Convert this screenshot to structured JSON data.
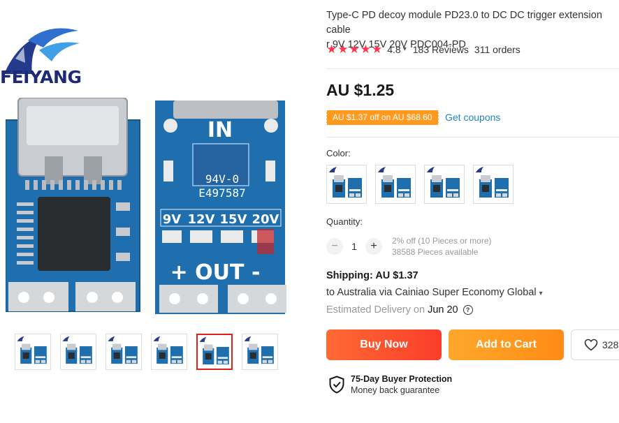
{
  "brand": {
    "logo_text": "FEIYANG"
  },
  "product": {
    "title": "Type-C PD decoy module PD23.0 to DC DC trigger extension cable\nr 9V 12V 15V 20V PDC004-PD",
    "rating": "4.8",
    "reviews": "183 Reviews",
    "orders": "311 orders",
    "price": "AU $1.25",
    "coupon_badge": "AU $1.37 off on AU $68.60",
    "get_coupons": "Get coupons",
    "board_labels": {
      "in": "IN",
      "out": "+ OUT -",
      "chip_text_1": "94V-0",
      "chip_text_2": "E497587",
      "voltages": [
        "9V",
        "12V",
        "15V",
        "20V"
      ]
    }
  },
  "gallery": {
    "thumbnail_count": 6,
    "active_index": 4
  },
  "options": {
    "color_label": "Color:",
    "swatch_count": 4
  },
  "quantity": {
    "label": "Quantity:",
    "value": "1",
    "minus": "−",
    "plus": "+",
    "discount": "2% off (10 Pieces or more)",
    "available": "38588 Pieces available"
  },
  "shipping": {
    "title": "Shipping: AU $1.37",
    "destination": "to Australia via Cainiao Super Economy Global",
    "estimated_prefix": "Estimated Delivery on ",
    "estimated_date": "Jun 20"
  },
  "actions": {
    "buy_now": "Buy Now",
    "add_to_cart": "Add to Cart",
    "wishlist_count": "328"
  },
  "protection": {
    "title": "75-Day Buyer Protection",
    "subtitle": "Money back guarantee"
  },
  "colors": {
    "accent_red": "#fd384f",
    "buy_button": "#fb3d2b",
    "cart_button": "#ff8b16",
    "coupon_badge": "#ff9a1f",
    "link_blue": "#2086c2",
    "pcb_blue": "#1f6fae"
  },
  "icons": {
    "star": "star-icon",
    "chevron": "chevron-down-icon",
    "help": "question-circle-icon",
    "heart": "heart-icon",
    "shield": "shield-check-icon"
  }
}
